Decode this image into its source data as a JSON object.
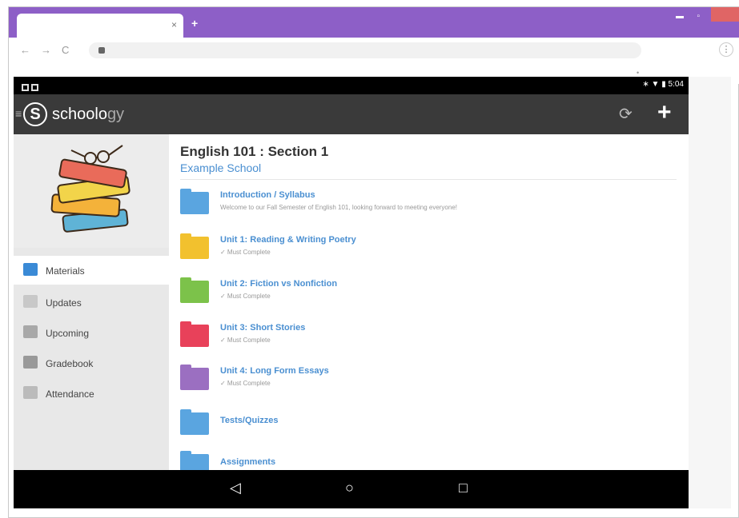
{
  "browser": {
    "tab_close": "×",
    "new_tab": "+",
    "nav_back": "←",
    "nav_forward": "→",
    "nav_reload": "C",
    "menu": "⋮"
  },
  "android": {
    "status_time": "5:04",
    "app_name_main": "schoolo",
    "app_name_accent": "gy"
  },
  "sidebar": {
    "items": [
      {
        "label": "Materials",
        "active": true,
        "icon": "materials-icon",
        "color": "#3a8ad6"
      },
      {
        "label": "Updates",
        "active": false,
        "icon": "updates-icon",
        "color": "#aaaaaa"
      },
      {
        "label": "Upcoming",
        "active": false,
        "icon": "calendar-icon",
        "color": "#888888"
      },
      {
        "label": "Gradebook",
        "active": false,
        "icon": "gradebook-icon",
        "color": "#888888"
      },
      {
        "label": "Attendance",
        "active": false,
        "icon": "attendance-icon",
        "color": "#aaaaaa"
      }
    ]
  },
  "course": {
    "title": "English 101 : Section 1",
    "school": "Example School"
  },
  "folders": [
    {
      "title": "Introduction / Syllabus",
      "subtitle": "Welcome to our Fall Semester of English 101, looking forward to meeting everyone!",
      "color": "#5aa5e0"
    },
    {
      "title": "Unit 1: Reading & Writing Poetry",
      "subtitle": "✓ Must Complete",
      "color": "#f2c12e"
    },
    {
      "title": "Unit 2: Fiction vs Nonfiction",
      "subtitle": "✓ Must Complete",
      "color": "#7cc24a"
    },
    {
      "title": "Unit 3: Short Stories",
      "subtitle": "✓ Must Complete",
      "color": "#e8415a"
    },
    {
      "title": "Unit 4: Long Form Essays",
      "subtitle": "✓ Must Complete",
      "color": "#9b6fc1"
    },
    {
      "title": "Tests/Quizzes",
      "subtitle": "",
      "color": "#5aa5e0"
    },
    {
      "title": "Assignments",
      "subtitle": "",
      "color": "#5aa5e0"
    }
  ],
  "navbar": {
    "back": "◁",
    "home": "○",
    "recents": "□"
  }
}
